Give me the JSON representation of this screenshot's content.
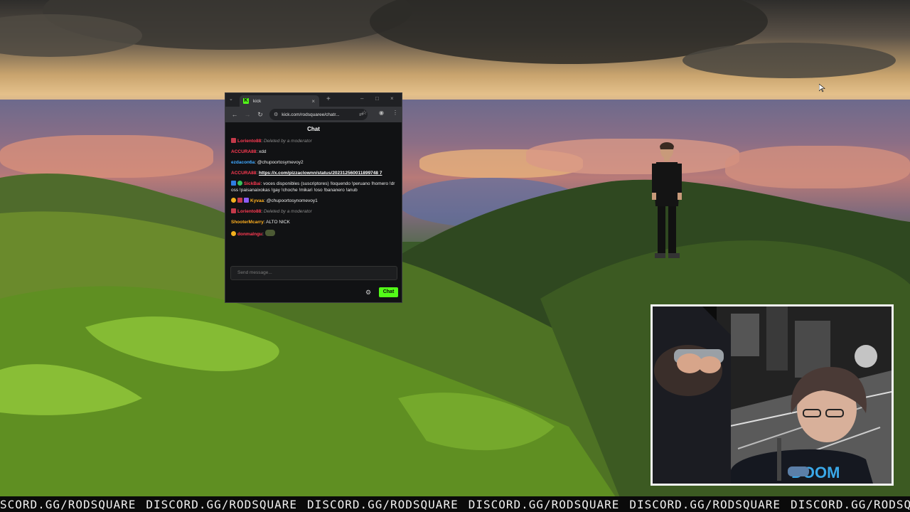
{
  "browser": {
    "tab_title": "kick",
    "url": "kick.com/rodsquaree/chatr...",
    "chat_title": "Chat",
    "input_placeholder": "Send message...",
    "send_label": "Chat",
    "accent_color": "#53fc18"
  },
  "chat": {
    "messages": [
      {
        "user": "Loriento88",
        "sep": ": ",
        "text": "Deleted by a moderator",
        "deleted": true,
        "user_color": "#ff3b52"
      },
      {
        "user": "ACCURA88",
        "sep": ": ",
        "text": "xdd",
        "user_color": "#ff3b52"
      },
      {
        "user": "ezdacon6a",
        "sep": ": ",
        "text": "@chupoortosymevoy2",
        "user_color": "#40a9ff"
      },
      {
        "user": "ACCURA88",
        "sep": ": ",
        "text": "https://x.com/pizzaclownn/status/202312560011899748 7",
        "link": true,
        "user_color": "#ff3b52"
      },
      {
        "user": "SickBai",
        "sep": ": ",
        "text": "voces disponibles (suscriptores) !loquendo !peruano !homero !dross !paisanaixokas !gay !choche !mikari !oso !bananero !anub",
        "user_color": "#ff3b52"
      },
      {
        "user": "Kyvaa",
        "sep": ": ",
        "text": "@chupoortosynomevoy1",
        "user_color": "#ffb020"
      },
      {
        "user": "Loriento88",
        "sep": ": ",
        "text": "Deleted by a moderator",
        "deleted": true,
        "user_color": "#ff3b52"
      },
      {
        "user": "ShooterMcarry",
        "sep": ": ",
        "text": "ALTO NICK",
        "user_color": "#ffb020"
      },
      {
        "user": "donmalngu",
        "sep": ": ",
        "text": "",
        "user_color": "#ff3b52"
      }
    ]
  },
  "ticker": {
    "items": [
      "SCORD.GG/RODSQUARE",
      "DISCORD.GG/RODSQUARE",
      "DISCORD.GG/RODSQUARE",
      "DISCORD.GG/RODSQUARE",
      "DISCORD.GG/RODSQUARE",
      "DISCORD.GG/RODSQUARE"
    ]
  }
}
